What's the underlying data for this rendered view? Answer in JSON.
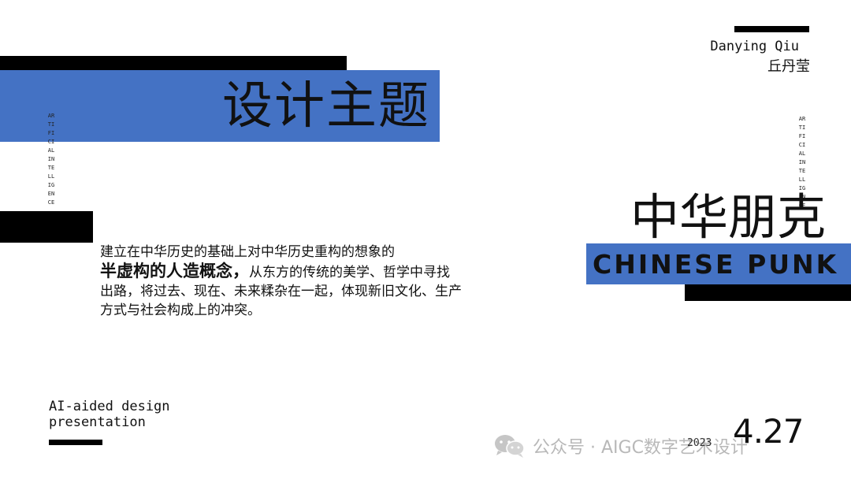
{
  "slide": {
    "title_main": "设计主题",
    "author_en": "Danying Qiu",
    "author_cn": "丘丹莹",
    "vertical_text_left": "ARTIFICIAL INTELLIGENCE",
    "vertical_text_right": "ARTIFICIAL INTELLIGENCE",
    "body": {
      "line1": "建立在中华历史的基础上对中华历史重构的想象的",
      "bold_phrase": "半虚构的人造概念，",
      "rest": "从东方的传统的美学、哲学中寻找出路，将过去、现在、未来糅杂在一起，体现新旧文化、生产方式与社会构成上的冲突。"
    },
    "title_cn": "中华朋克",
    "title_en": "CHINESE PUNK",
    "ai_line1": "AI-aided design",
    "ai_line2": "presentation",
    "year": "2023",
    "date": "4.27"
  },
  "watermark": {
    "text": "公众号 · AIGC数字艺术设计",
    "icon": "wechat-icon"
  },
  "colors": {
    "accent_blue": "#4472c4",
    "black": "#000000",
    "watermark_gray": "#b8b8b8"
  }
}
